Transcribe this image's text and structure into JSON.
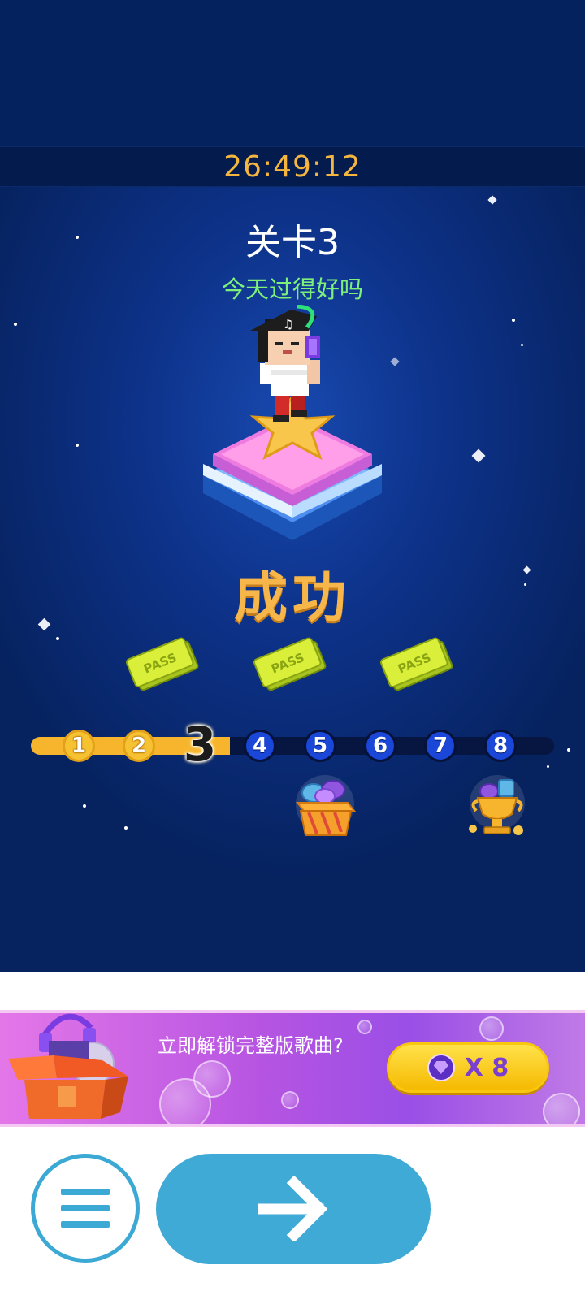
{
  "timer": "26:49:12",
  "level": {
    "title": "关卡3",
    "subtitle": "今天过得好吗",
    "status": "成功"
  },
  "tickets": [
    {
      "label": "PASS"
    },
    {
      "label": "PASS"
    },
    {
      "label": "PASS"
    }
  ],
  "progress": {
    "nodes": [
      "1",
      "2",
      "3",
      "4",
      "5",
      "6",
      "7",
      "8"
    ],
    "current": "3",
    "completed_count": 3
  },
  "rewards": [
    {
      "icon": "gift-box-icon",
      "at_level": "5"
    },
    {
      "icon": "trophy-icon",
      "at_level": "8"
    }
  ],
  "banner": {
    "text": "立即解锁完整版歌曲?",
    "button_cost": "X 8",
    "button_icon": "diamond-icon"
  },
  "nav": {
    "menu_icon": "menu-icon",
    "next_icon": "arrow-right-icon"
  },
  "colors": {
    "accent_gold": "#f7b64a",
    "subtitle_green": "#7ef07a",
    "button_blue": "#3faad6",
    "node_blue": "#1a47d8"
  }
}
